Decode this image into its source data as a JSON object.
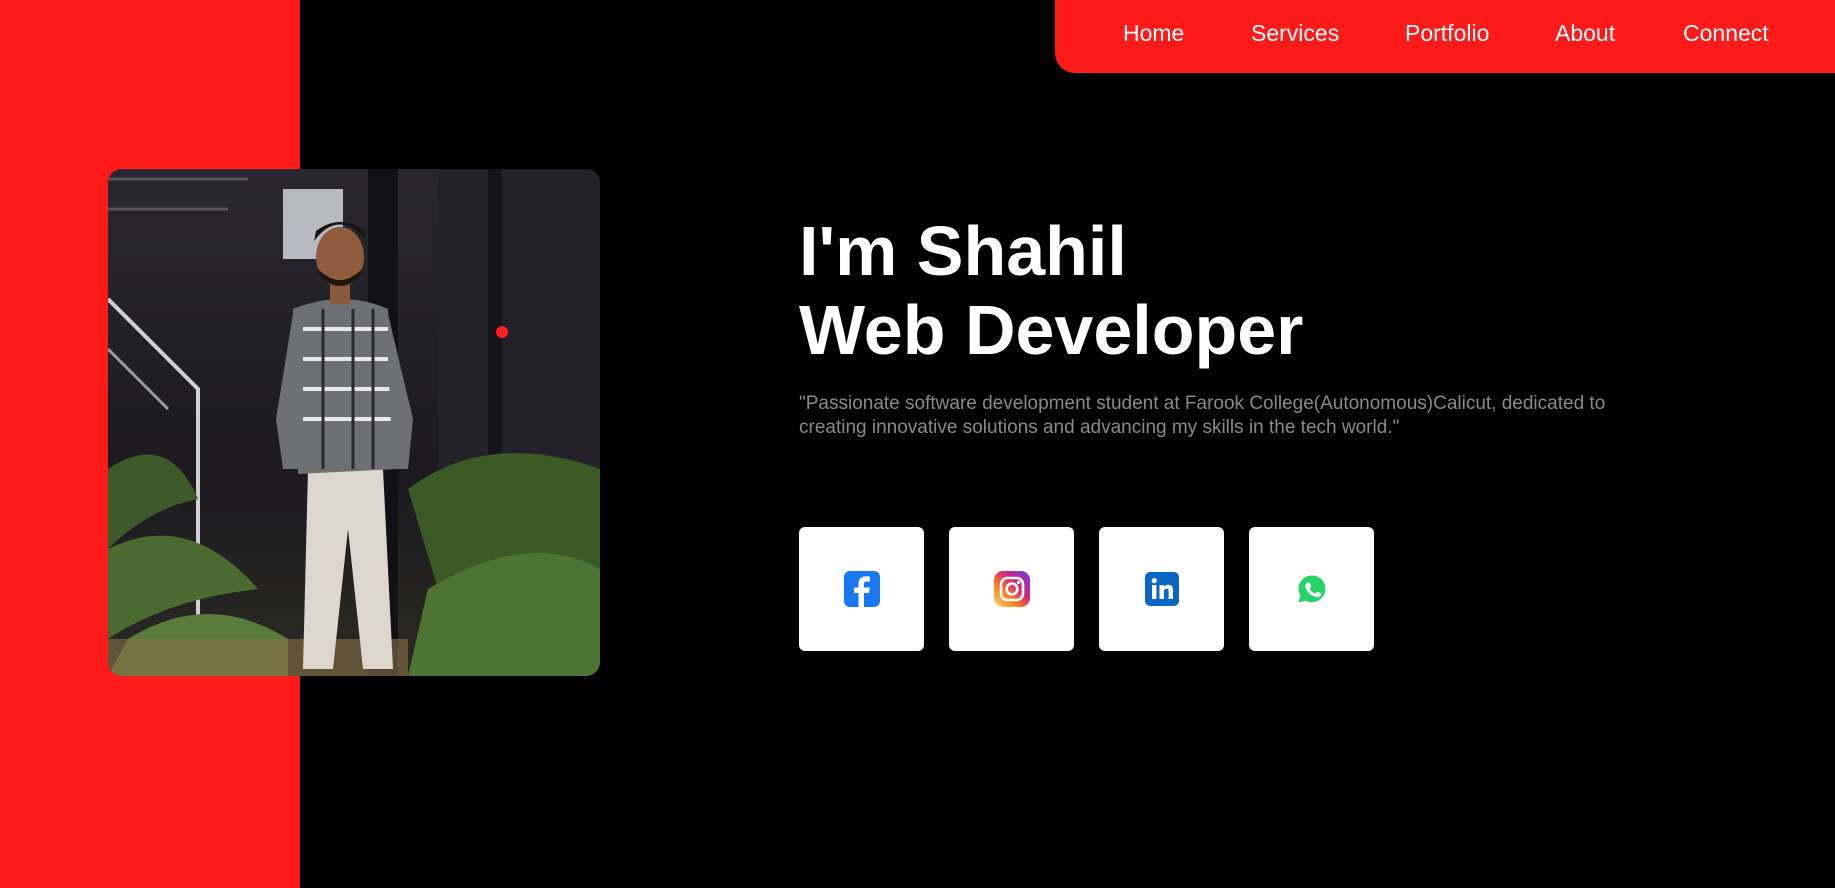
{
  "nav": {
    "items": [
      {
        "label": "Home"
      },
      {
        "label": "Services"
      },
      {
        "label": "Portfolio"
      },
      {
        "label": "About"
      },
      {
        "label": "Connect"
      }
    ]
  },
  "hero": {
    "title_line1": "I'm Shahil",
    "title_line2": "Web Developer",
    "quote": "\"Passionate software development student at Farook College(Autonomous)Calicut, dedicated to creating innovative solutions and advancing my skills in the tech world.\""
  },
  "socials": [
    {
      "icon": "facebook-icon",
      "color": "#1877f2"
    },
    {
      "icon": "instagram-icon",
      "color": "#e1306c"
    },
    {
      "icon": "linkedin-icon",
      "color": "#0a66c2"
    },
    {
      "icon": "whatsapp-icon",
      "color": "#25d366"
    }
  ],
  "colors": {
    "accent": "#ff1a1a",
    "background": "#000000",
    "text": "#ffffff",
    "muted": "#8a8a8a"
  }
}
